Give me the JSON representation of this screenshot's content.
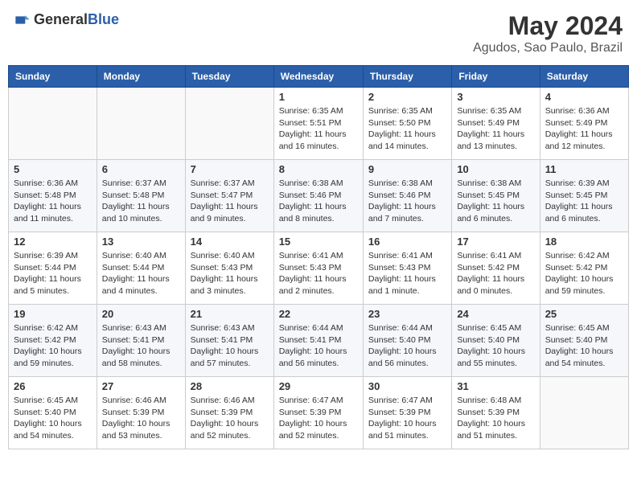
{
  "header": {
    "logo_general": "General",
    "logo_blue": "Blue",
    "title": "May 2024",
    "subtitle": "Agudos, Sao Paulo, Brazil"
  },
  "columns": [
    "Sunday",
    "Monday",
    "Tuesday",
    "Wednesday",
    "Thursday",
    "Friday",
    "Saturday"
  ],
  "weeks": [
    [
      {
        "day": "",
        "info": ""
      },
      {
        "day": "",
        "info": ""
      },
      {
        "day": "",
        "info": ""
      },
      {
        "day": "1",
        "info": "Sunrise: 6:35 AM\nSunset: 5:51 PM\nDaylight: 11 hours and 16 minutes."
      },
      {
        "day": "2",
        "info": "Sunrise: 6:35 AM\nSunset: 5:50 PM\nDaylight: 11 hours and 14 minutes."
      },
      {
        "day": "3",
        "info": "Sunrise: 6:35 AM\nSunset: 5:49 PM\nDaylight: 11 hours and 13 minutes."
      },
      {
        "day": "4",
        "info": "Sunrise: 6:36 AM\nSunset: 5:49 PM\nDaylight: 11 hours and 12 minutes."
      }
    ],
    [
      {
        "day": "5",
        "info": "Sunrise: 6:36 AM\nSunset: 5:48 PM\nDaylight: 11 hours and 11 minutes."
      },
      {
        "day": "6",
        "info": "Sunrise: 6:37 AM\nSunset: 5:48 PM\nDaylight: 11 hours and 10 minutes."
      },
      {
        "day": "7",
        "info": "Sunrise: 6:37 AM\nSunset: 5:47 PM\nDaylight: 11 hours and 9 minutes."
      },
      {
        "day": "8",
        "info": "Sunrise: 6:38 AM\nSunset: 5:46 PM\nDaylight: 11 hours and 8 minutes."
      },
      {
        "day": "9",
        "info": "Sunrise: 6:38 AM\nSunset: 5:46 PM\nDaylight: 11 hours and 7 minutes."
      },
      {
        "day": "10",
        "info": "Sunrise: 6:38 AM\nSunset: 5:45 PM\nDaylight: 11 hours and 6 minutes."
      },
      {
        "day": "11",
        "info": "Sunrise: 6:39 AM\nSunset: 5:45 PM\nDaylight: 11 hours and 6 minutes."
      }
    ],
    [
      {
        "day": "12",
        "info": "Sunrise: 6:39 AM\nSunset: 5:44 PM\nDaylight: 11 hours and 5 minutes."
      },
      {
        "day": "13",
        "info": "Sunrise: 6:40 AM\nSunset: 5:44 PM\nDaylight: 11 hours and 4 minutes."
      },
      {
        "day": "14",
        "info": "Sunrise: 6:40 AM\nSunset: 5:43 PM\nDaylight: 11 hours and 3 minutes."
      },
      {
        "day": "15",
        "info": "Sunrise: 6:41 AM\nSunset: 5:43 PM\nDaylight: 11 hours and 2 minutes."
      },
      {
        "day": "16",
        "info": "Sunrise: 6:41 AM\nSunset: 5:43 PM\nDaylight: 11 hours and 1 minute."
      },
      {
        "day": "17",
        "info": "Sunrise: 6:41 AM\nSunset: 5:42 PM\nDaylight: 11 hours and 0 minutes."
      },
      {
        "day": "18",
        "info": "Sunrise: 6:42 AM\nSunset: 5:42 PM\nDaylight: 10 hours and 59 minutes."
      }
    ],
    [
      {
        "day": "19",
        "info": "Sunrise: 6:42 AM\nSunset: 5:42 PM\nDaylight: 10 hours and 59 minutes."
      },
      {
        "day": "20",
        "info": "Sunrise: 6:43 AM\nSunset: 5:41 PM\nDaylight: 10 hours and 58 minutes."
      },
      {
        "day": "21",
        "info": "Sunrise: 6:43 AM\nSunset: 5:41 PM\nDaylight: 10 hours and 57 minutes."
      },
      {
        "day": "22",
        "info": "Sunrise: 6:44 AM\nSunset: 5:41 PM\nDaylight: 10 hours and 56 minutes."
      },
      {
        "day": "23",
        "info": "Sunrise: 6:44 AM\nSunset: 5:40 PM\nDaylight: 10 hours and 56 minutes."
      },
      {
        "day": "24",
        "info": "Sunrise: 6:45 AM\nSunset: 5:40 PM\nDaylight: 10 hours and 55 minutes."
      },
      {
        "day": "25",
        "info": "Sunrise: 6:45 AM\nSunset: 5:40 PM\nDaylight: 10 hours and 54 minutes."
      }
    ],
    [
      {
        "day": "26",
        "info": "Sunrise: 6:45 AM\nSunset: 5:40 PM\nDaylight: 10 hours and 54 minutes."
      },
      {
        "day": "27",
        "info": "Sunrise: 6:46 AM\nSunset: 5:39 PM\nDaylight: 10 hours and 53 minutes."
      },
      {
        "day": "28",
        "info": "Sunrise: 6:46 AM\nSunset: 5:39 PM\nDaylight: 10 hours and 52 minutes."
      },
      {
        "day": "29",
        "info": "Sunrise: 6:47 AM\nSunset: 5:39 PM\nDaylight: 10 hours and 52 minutes."
      },
      {
        "day": "30",
        "info": "Sunrise: 6:47 AM\nSunset: 5:39 PM\nDaylight: 10 hours and 51 minutes."
      },
      {
        "day": "31",
        "info": "Sunrise: 6:48 AM\nSunset: 5:39 PM\nDaylight: 10 hours and 51 minutes."
      },
      {
        "day": "",
        "info": ""
      }
    ]
  ]
}
